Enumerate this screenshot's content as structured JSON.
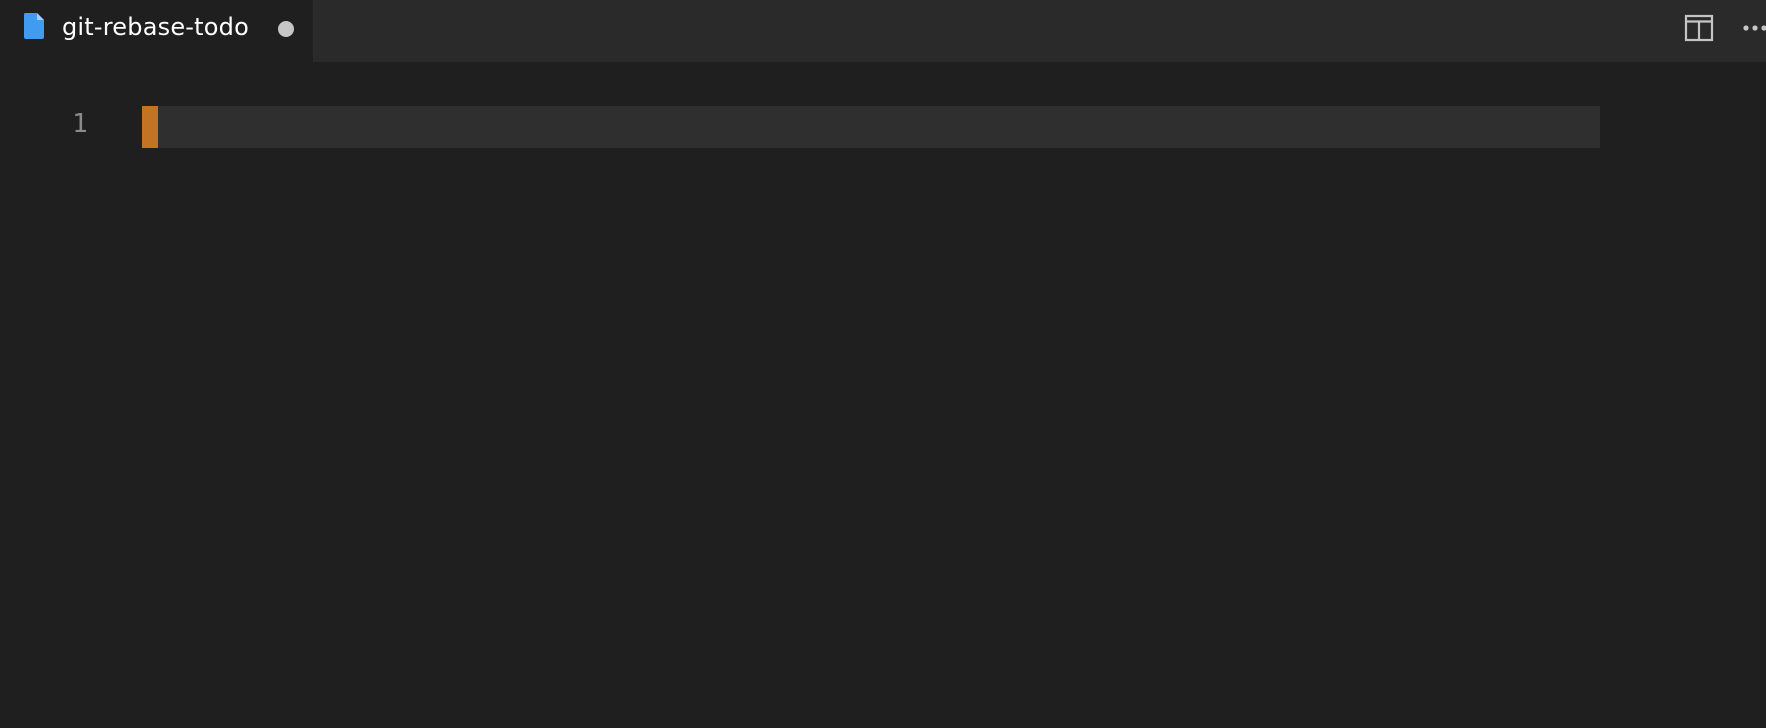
{
  "tab": {
    "title": "git-rebase-todo",
    "file_icon": "file-icon",
    "modified": true
  },
  "toolbar": {
    "split_editor_icon": "split-editor-icon",
    "more_actions_icon": "more-actions-icon"
  },
  "editor": {
    "line_numbers": [
      "1"
    ],
    "content": ""
  },
  "colors": {
    "file_icon": "#3f9cf0",
    "cursor": "#c27423",
    "background": "#1f1f1f",
    "tabbar": "#2a2a2a",
    "current_line": "#2f2f2f"
  }
}
